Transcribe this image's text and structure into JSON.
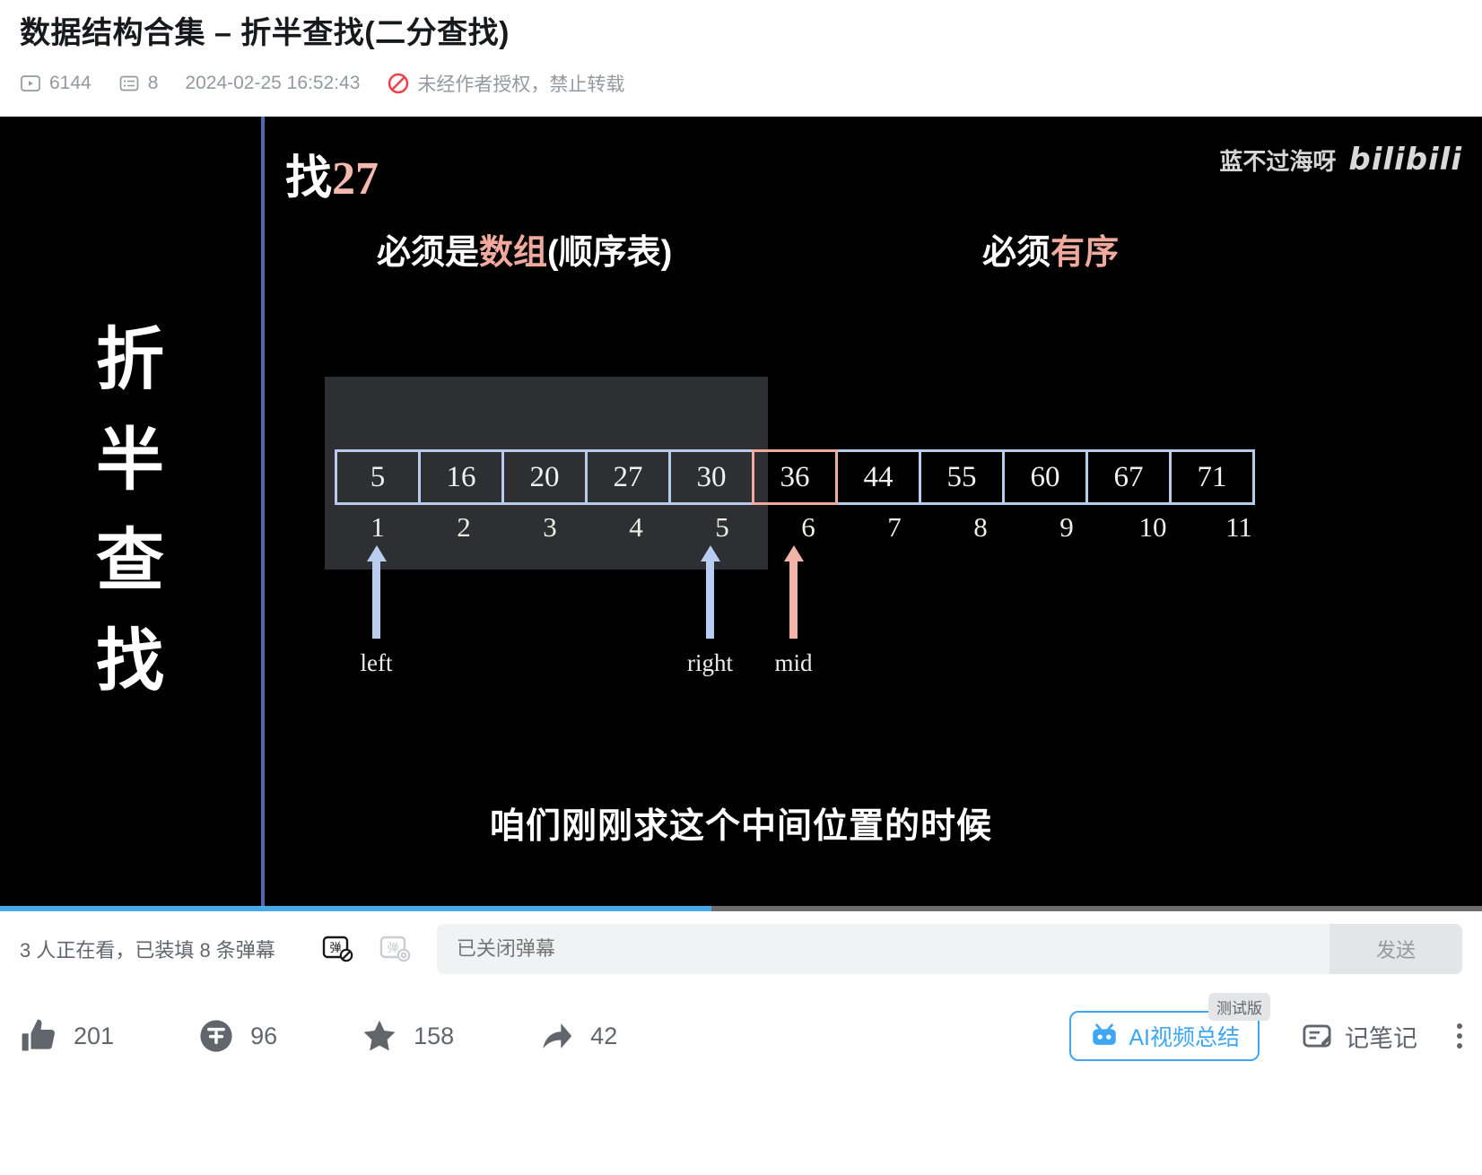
{
  "header": {
    "title": "数据结构合集 – 折半查找(二分查找)",
    "views": "6144",
    "comments": "8",
    "publish_date": "2024-02-25 16:52:43",
    "copyright": "未经作者授权，禁止转载"
  },
  "player": {
    "vertical_title_chars": [
      "折",
      "半",
      "查",
      "找"
    ],
    "find_prefix": "找",
    "find_target": "27",
    "condition_left_prefix": "必须是",
    "condition_left_highlight": "数组",
    "condition_left_suffix": "(顺序表)",
    "condition_right_prefix": "必须",
    "condition_right_highlight": "有序",
    "watermark_author": "蓝不过海呀",
    "watermark_logo": "bilibili",
    "subtitle": "咱们刚刚求这个中间位置的时候",
    "progress_percent": 48,
    "colors": {
      "accent_blue": "#b6ccea",
      "accent_pink": "#f0a99d",
      "progress": "#48a8e8"
    },
    "array": {
      "values": [
        "5",
        "16",
        "20",
        "27",
        "30",
        "36",
        "44",
        "55",
        "60",
        "67",
        "71"
      ],
      "indices": [
        "1",
        "2",
        "3",
        "4",
        "5",
        "6",
        "7",
        "8",
        "9",
        "10",
        "11"
      ],
      "mid_index": 5
    },
    "pointers": [
      {
        "label": "left",
        "index": 0,
        "color": "blue"
      },
      {
        "label": "right",
        "index": 4,
        "color": "blue"
      },
      {
        "label": "mid",
        "index": 5,
        "color": "pink"
      }
    ]
  },
  "danmaku": {
    "status": "3 人正在看，已装填 8 条弹幕",
    "input_placeholder": "已关闭弹幕",
    "send_label": "发送"
  },
  "toolbar": {
    "like_count": "201",
    "coin_count": "96",
    "favorite_count": "158",
    "share_count": "42",
    "ai_summary_label": "AI视频总结",
    "ai_summary_badge": "测试版",
    "note_label": "记笔记"
  }
}
